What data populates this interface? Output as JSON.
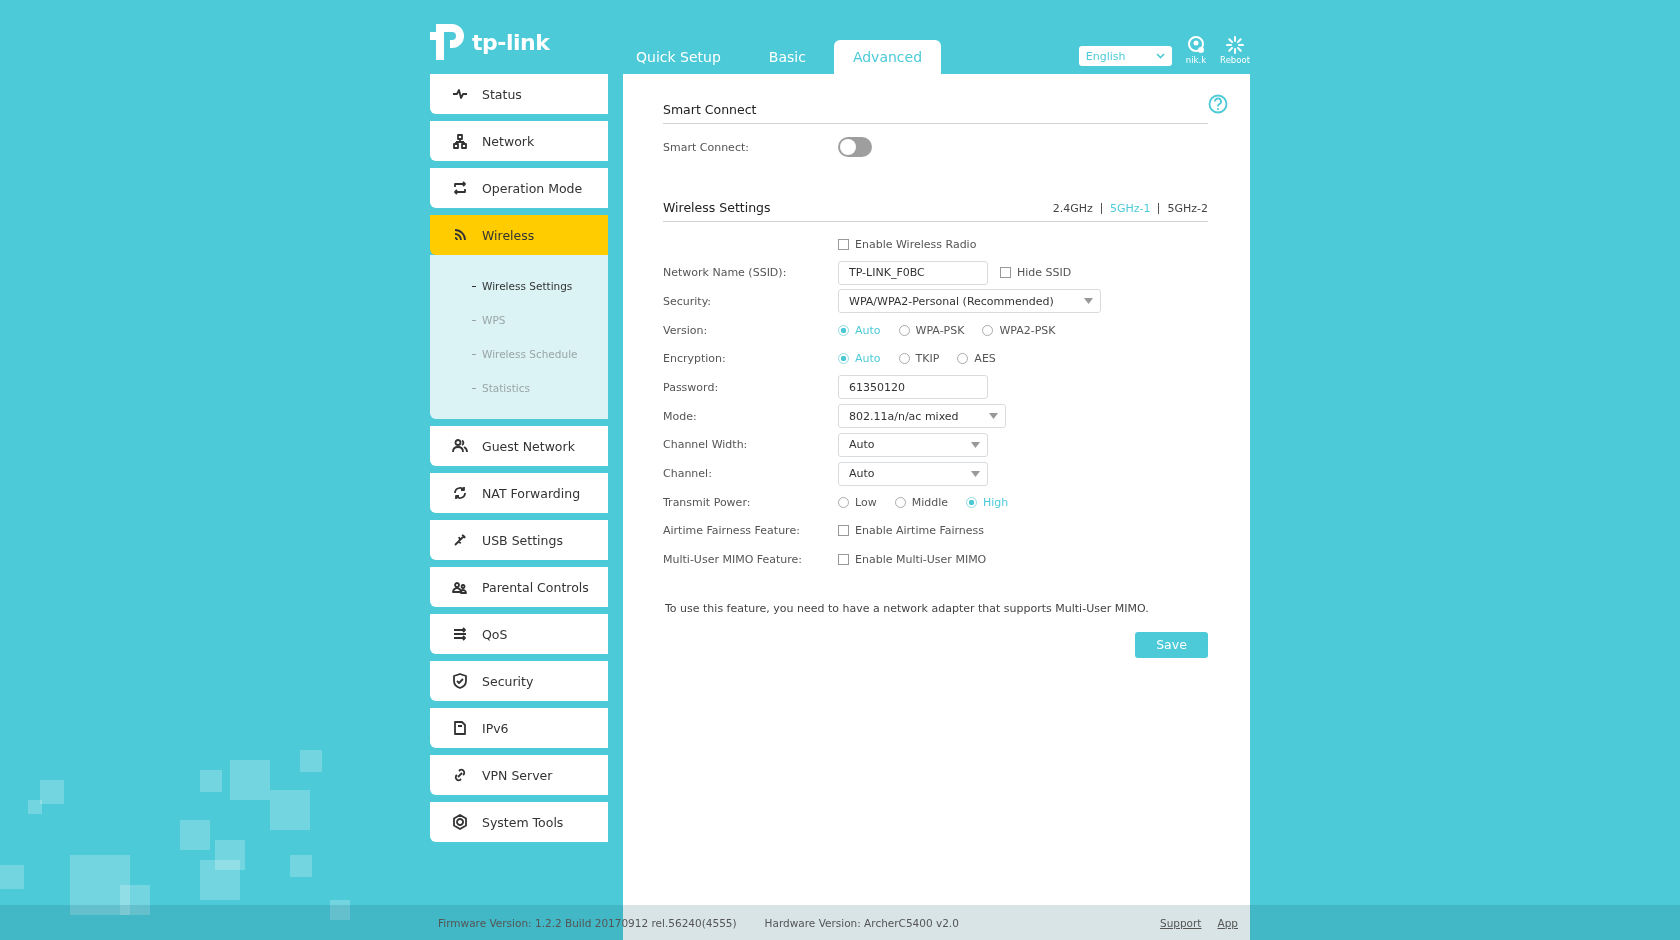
{
  "header": {
    "logo": "tp-link",
    "tabs": [
      {
        "label": "Quick Setup",
        "selected": false
      },
      {
        "label": "Basic",
        "selected": false
      },
      {
        "label": "Advanced",
        "selected": true
      }
    ],
    "language": "English",
    "user": "nik.k",
    "reboot": "Reboot"
  },
  "sidebar": {
    "items": [
      {
        "label": "Status",
        "selected": false
      },
      {
        "label": "Network",
        "selected": false
      },
      {
        "label": "Operation Mode",
        "selected": false
      },
      {
        "label": "Wireless",
        "selected": true,
        "children": [
          {
            "label": "Wireless Settings",
            "selected": true
          },
          {
            "label": "WPS",
            "selected": false
          },
          {
            "label": "Wireless Schedule",
            "selected": false
          },
          {
            "label": "Statistics",
            "selected": false
          }
        ]
      },
      {
        "label": "Guest Network",
        "selected": false
      },
      {
        "label": "NAT Forwarding",
        "selected": false
      },
      {
        "label": "USB Settings",
        "selected": false
      },
      {
        "label": "Parental Controls",
        "selected": false
      },
      {
        "label": "QoS",
        "selected": false
      },
      {
        "label": "Security",
        "selected": false
      },
      {
        "label": "IPv6",
        "selected": false
      },
      {
        "label": "VPN Server",
        "selected": false
      },
      {
        "label": "System Tools",
        "selected": false
      }
    ]
  },
  "smart_connect": {
    "title": "Smart Connect",
    "label": "Smart Connect:",
    "on": false
  },
  "wireless": {
    "title": "Wireless Settings",
    "bands": [
      {
        "label": "2.4GHz",
        "selected": false
      },
      {
        "label": "5GHz-1",
        "selected": true
      },
      {
        "label": "5GHz-2",
        "selected": false
      }
    ],
    "rows": [
      {
        "kind": "checkbox",
        "text": "Enable Wireless Radio",
        "checked": false
      },
      {
        "kind": "text",
        "label": "Network Name (SSID):",
        "value": "TP-LINK_F0BC",
        "extra": {
          "text": "Hide SSID",
          "checked": false
        }
      },
      {
        "kind": "select",
        "label": "Security:",
        "value": "WPA/WPA2-Personal (Recommended)"
      },
      {
        "kind": "radio",
        "label": "Version:",
        "options": [
          {
            "label": "Auto",
            "selected": true
          },
          {
            "label": "WPA-PSK",
            "selected": false
          },
          {
            "label": "WPA2-PSK",
            "selected": false
          }
        ]
      },
      {
        "kind": "radio",
        "label": "Encryption:",
        "options": [
          {
            "label": "Auto",
            "selected": true
          },
          {
            "label": "TKIP",
            "selected": false
          },
          {
            "label": "AES",
            "selected": false
          }
        ]
      },
      {
        "kind": "text",
        "label": "Password:",
        "value": "61350120"
      },
      {
        "kind": "select",
        "label": "Mode:",
        "value": "802.11a/n/ac mixed"
      },
      {
        "kind": "select",
        "label": "Channel Width:",
        "value": "Auto"
      },
      {
        "kind": "select",
        "label": "Channel:",
        "value": "Auto"
      },
      {
        "kind": "radio",
        "label": "Transmit Power:",
        "options": [
          {
            "label": "Low",
            "selected": false
          },
          {
            "label": "Middle",
            "selected": false
          },
          {
            "label": "High",
            "selected": true
          }
        ]
      },
      {
        "kind": "checkbox",
        "label": "Airtime Fairness Feature:",
        "text": "Enable Airtime Fairness",
        "checked": false
      },
      {
        "kind": "checkbox",
        "label": "Multi-User MIMO Feature:",
        "text": "Enable Multi-User MIMO",
        "checked": false
      }
    ],
    "note": "To use this feature, you need to have a network adapter that supports Multi-User MIMO.",
    "save": "Save"
  },
  "footer": {
    "firmware": "Firmware Version: 1.2.2 Build 20170912 rel.56240(4555)",
    "hardware": "Hardware Version: ArcherC5400 v2.0",
    "links": [
      "Support",
      "App"
    ]
  }
}
